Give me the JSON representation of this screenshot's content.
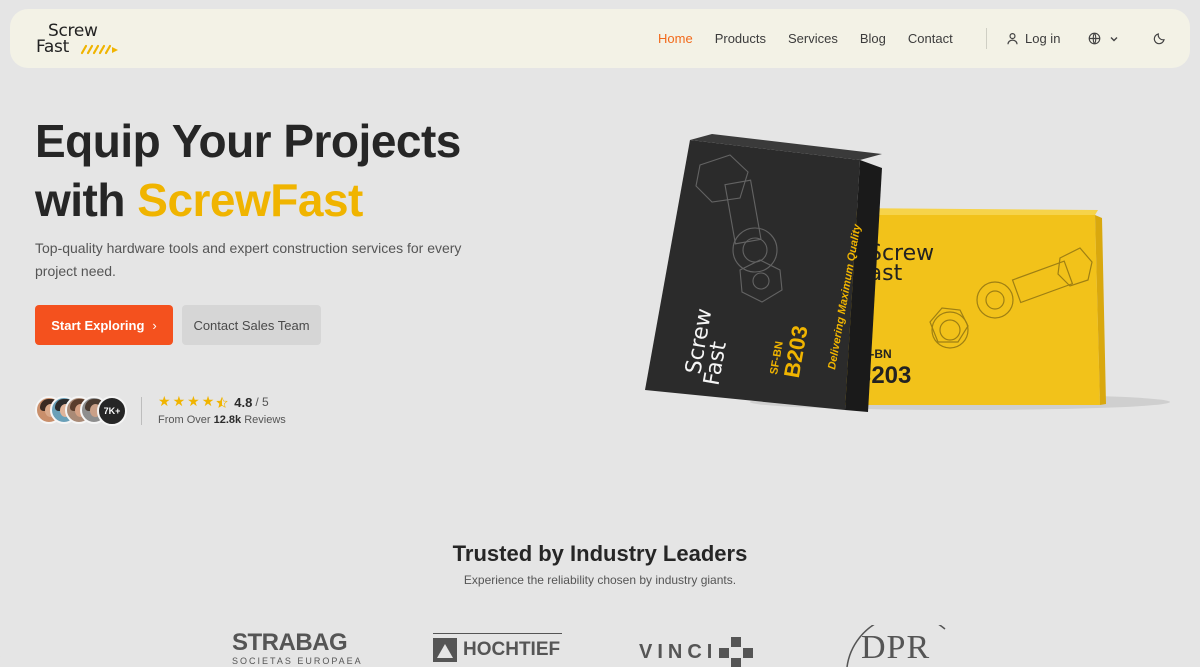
{
  "brand": {
    "line1": "Screw",
    "line2": "Fast"
  },
  "nav": {
    "items": [
      {
        "label": "Home",
        "active": true
      },
      {
        "label": "Products",
        "active": false
      },
      {
        "label": "Services",
        "active": false
      },
      {
        "label": "Blog",
        "active": false
      },
      {
        "label": "Contact",
        "active": false
      }
    ],
    "login_label": "Log in",
    "language_icon": "globe-icon",
    "theme_icon": "moon-icon"
  },
  "hero": {
    "title_line1": "Equip Your Projects",
    "title_with": "with ",
    "title_highlight": "ScrewFast",
    "subtitle": "Top-quality hardware tools and expert construction services for every project need.",
    "primary_cta": "Start Exploring",
    "secondary_cta": "Contact Sales Team",
    "avatar_count": "7K+",
    "rating": "4.8",
    "rating_max": "/ 5",
    "stars": 4.5,
    "reviews_prefix": "From Over ",
    "reviews_count": "12.8k",
    "reviews_suffix": " Reviews"
  },
  "product_image": {
    "black_box": {
      "logo1": "Screw",
      "logo2": "Fast",
      "code": "SF-BN",
      "model": "B203",
      "tagline": "Delivering Maximum Quality"
    },
    "yellow_box": {
      "logo1": "Screw",
      "logo2": "Fast",
      "code": "SF-BN",
      "model": "B203"
    }
  },
  "trusted": {
    "title": "Trusted by Industry Leaders",
    "subtitle": "Experience the reliability chosen by industry giants.",
    "logos": [
      {
        "name": "STRABAG",
        "sub": "SOCIETAS EUROPAEA"
      },
      {
        "name": "HOCHTIEF"
      },
      {
        "name": "VINCI"
      },
      {
        "name": "DPR"
      }
    ]
  },
  "colors": {
    "accent": "#f4511e",
    "highlight": "#f0b400",
    "nav_bg": "#f3f2e6",
    "page_bg": "#e5e5e5"
  }
}
